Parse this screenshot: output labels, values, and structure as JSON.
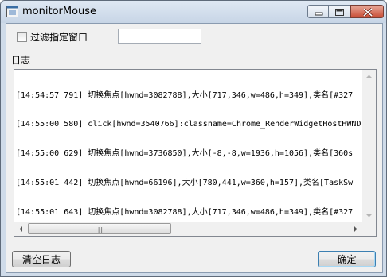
{
  "window": {
    "title": "monitorMouse",
    "icon": "app-window-icon",
    "controls": [
      "minimize-icon",
      "maximize-icon",
      "close-icon"
    ],
    "colors": {
      "titlebar": "#c7d5e6",
      "close": "#c84d35",
      "client": "#f0f0f0"
    }
  },
  "filter": {
    "checkbox_label": "过滤指定窗口",
    "checked": false,
    "input_value": ""
  },
  "log": {
    "label": "日志",
    "lines": [
      "[14:54:57 791] 切换焦点[hwnd=3082788],大小[717,346,w=486,h=349],类名[#327",
      "[14:55:00 580] click[hwnd=3540766]:classname=Chrome_RenderWidgetHostHWND,",
      "[14:55:00 629] 切换焦点[hwnd=3736850],大小[-8,-8,w=1936,h=1056],类名[360s",
      "[14:55:01 442] 切换焦点[hwnd=66196],大小[780,441,w=360,h=157],类名[TaskSw",
      "[14:55:01 643] 切换焦点[hwnd=3082788],大小[717,346,w=486,h=349],类名[#327"
    ]
  },
  "buttons": {
    "clear_label": "清空日志",
    "ok_label": "确定"
  }
}
